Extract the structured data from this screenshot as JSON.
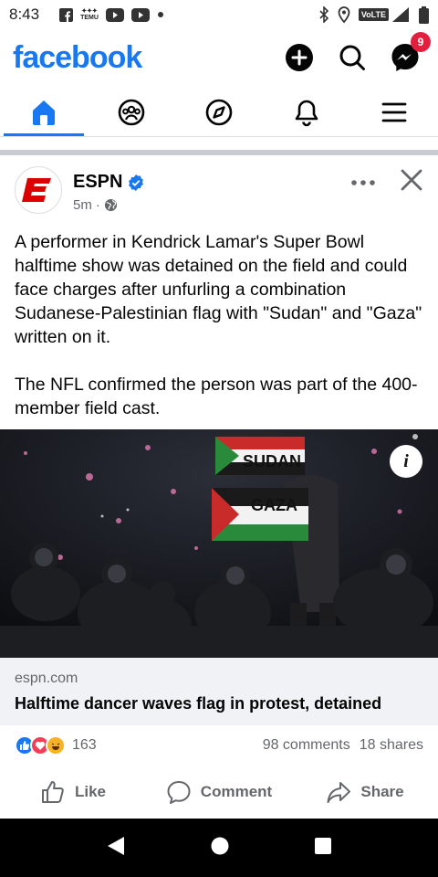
{
  "status_bar": {
    "time": "8:43",
    "left_icons": [
      "facebook-notif-icon",
      "temu-icon",
      "youtube-icon",
      "youtube-icon",
      "dot-icon"
    ],
    "temu_label": "TEMU",
    "network_label": "VoLTE",
    "network_type": "4G",
    "right_icons": [
      "bluetooth-icon",
      "location-icon",
      "signal-icon",
      "battery-icon"
    ]
  },
  "app": {
    "logo": "facebook",
    "messenger_badge": "9",
    "brand_color": "#1877f2"
  },
  "nav_tabs": [
    {
      "name": "home",
      "icon": "home-icon",
      "active": true
    },
    {
      "name": "groups",
      "icon": "groups-icon",
      "active": false
    },
    {
      "name": "explore",
      "icon": "compass-icon",
      "active": false
    },
    {
      "name": "notifications",
      "icon": "bell-icon",
      "active": false
    },
    {
      "name": "menu",
      "icon": "hamburger-icon",
      "active": false
    }
  ],
  "post": {
    "author": "ESPN",
    "verified": true,
    "time": "5m",
    "time_separator": "·",
    "audience_icon": "globe-icon",
    "text_paragraphs": [
      "A performer in Kendrick Lamar's Super Bowl halftime show was detained on the field and could face charges after unfurling a combination Sudanese-Palestinian flag with \"Sudan\" and \"Gaza\" written on it.",
      "The NFL confirmed the person was part of the 400-member field cast."
    ],
    "image": {
      "flag_text_top": "SUDAN",
      "flag_text_bottom": "GAZA",
      "info_button": "i"
    },
    "link": {
      "domain": "espn.com",
      "title": "Halftime dancer waves flag in protest, detained"
    },
    "reactions": {
      "types": [
        "like",
        "love",
        "haha"
      ],
      "count": "163",
      "comments": "98 comments",
      "shares": "18 shares"
    },
    "actions": {
      "like": "Like",
      "comment": "Comment",
      "share": "Share"
    }
  }
}
